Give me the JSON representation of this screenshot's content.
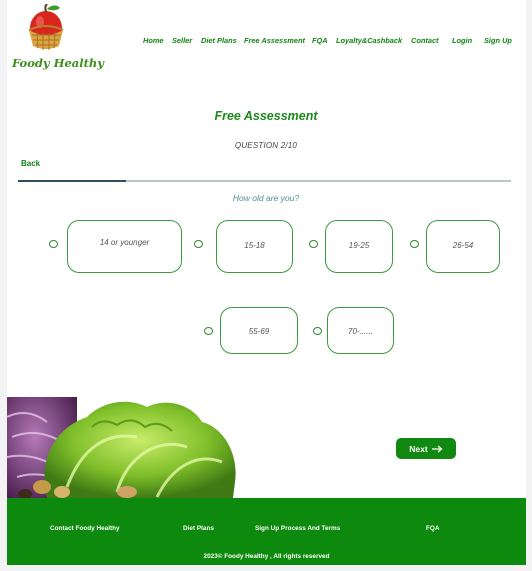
{
  "brand": {
    "name": "Foody Healthy"
  },
  "nav": {
    "items": [
      "Home",
      "Seller",
      "Diet Plans",
      "Free Assessment",
      "FQA",
      "Loyalty&Cashback",
      "Contact",
      "Login",
      "Sign Up"
    ]
  },
  "assessment": {
    "title": "Free Assessment",
    "question_count": "QUESTION 2/10",
    "back_label": "Back",
    "progress": 0.22,
    "question": "How old are you?",
    "options": [
      "14 or younger",
      "15-18",
      "19-25",
      "26-54",
      "55-69",
      "70-......"
    ],
    "next_label": "Next"
  },
  "footer": {
    "links": [
      "Contact Foody Healthy",
      "Diet Plans",
      "Sign Up Process And Terms",
      "FQA"
    ],
    "copyright": "2023© Foody Healthy , All rights reserved"
  },
  "colors": {
    "brand_green": "#118811",
    "progress_fill": "#2f4f58",
    "footer_bg": "#0d8a0d"
  }
}
